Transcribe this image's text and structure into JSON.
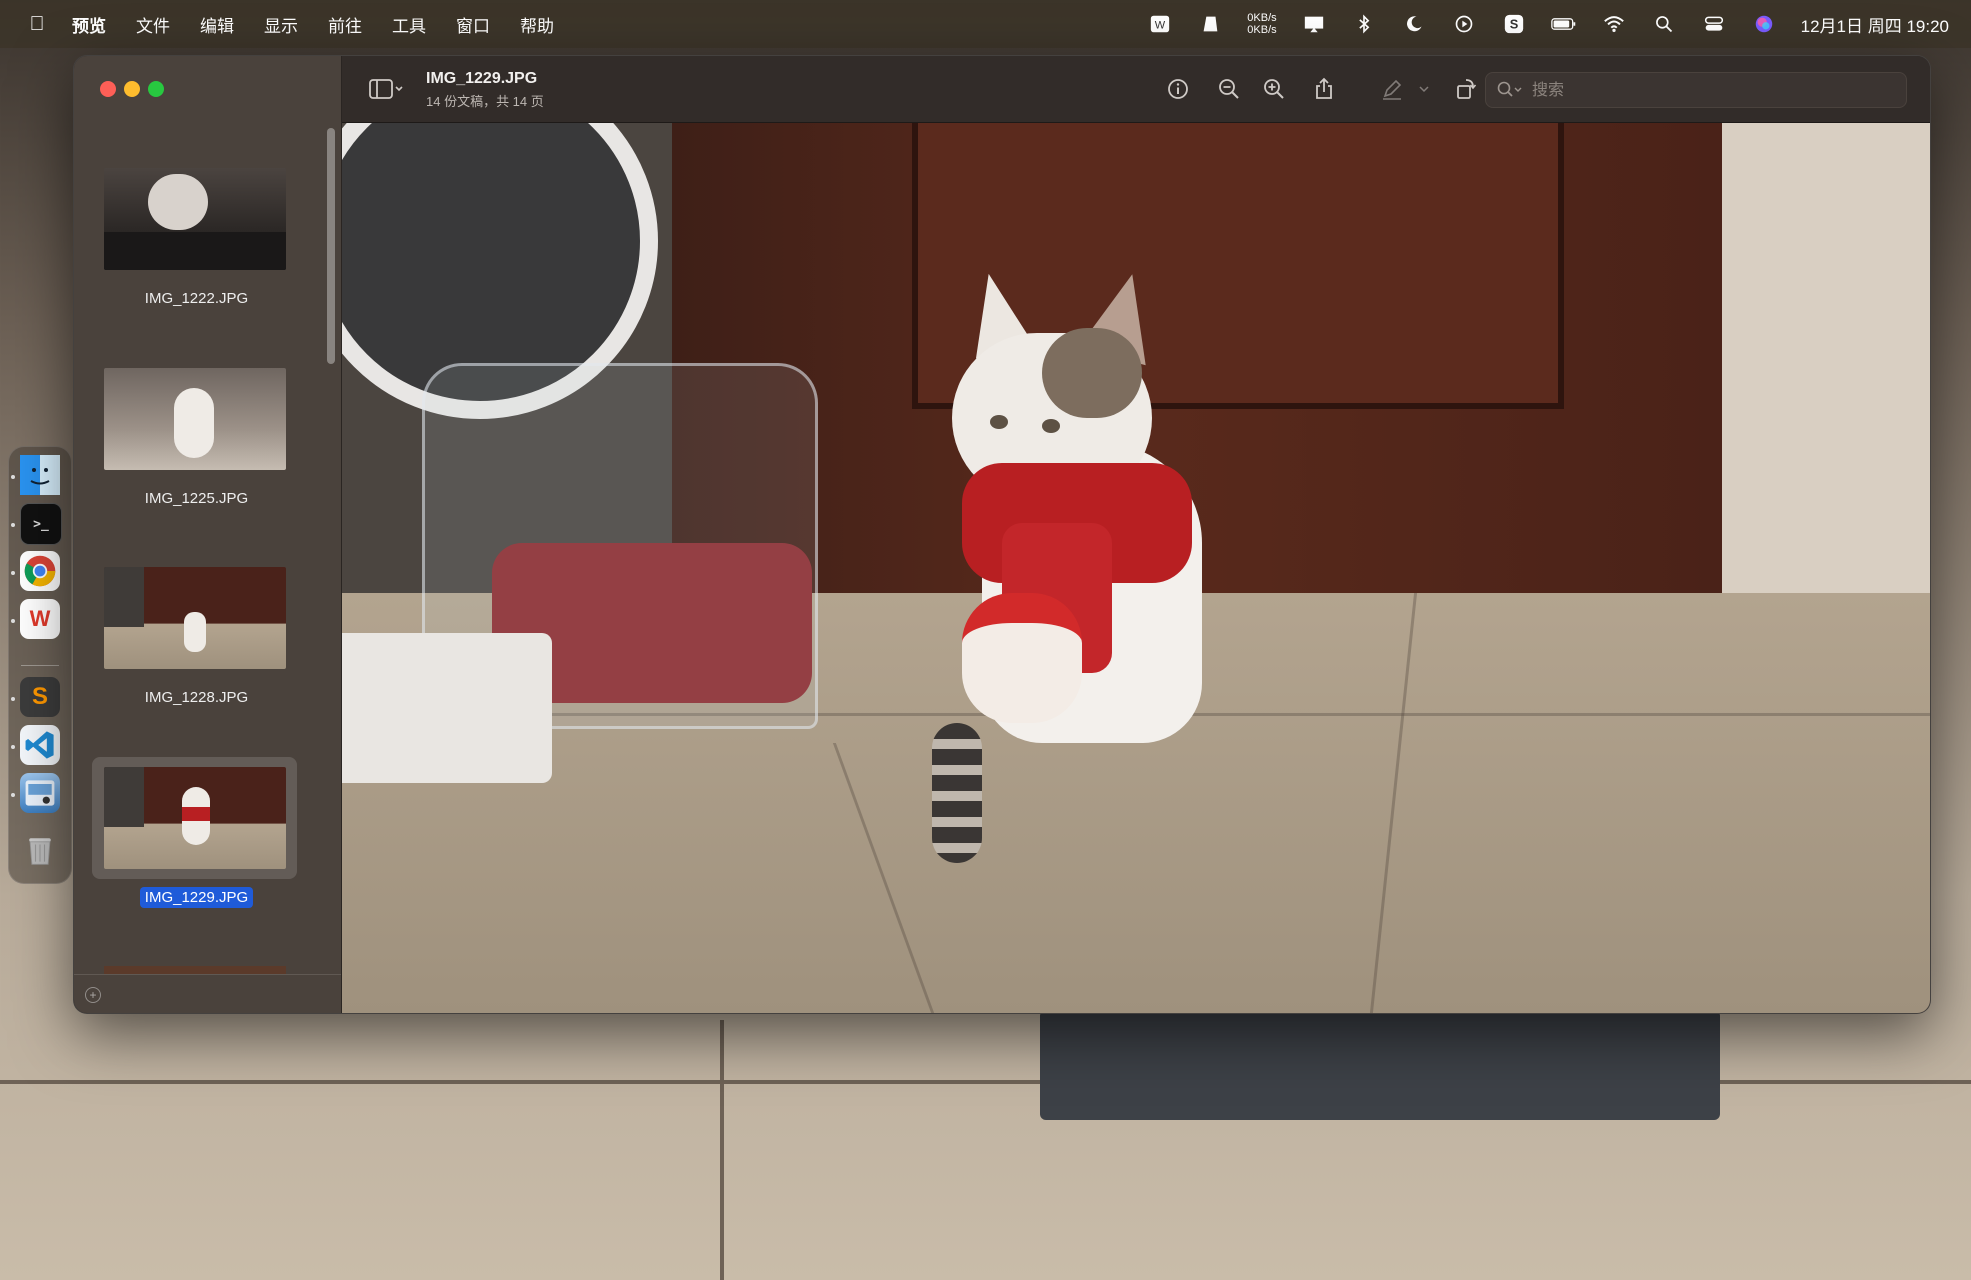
{
  "menubar": {
    "app_name": "预览",
    "items": [
      "文件",
      "编辑",
      "显示",
      "前往",
      "工具",
      "窗口",
      "帮助"
    ],
    "netspeed_up": "0KB/s",
    "netspeed_down": "0KB/s",
    "clock": "12月1日 周四 19:20"
  },
  "dock": {
    "apps": [
      "finder",
      "terminal",
      "chrome",
      "wps",
      "sublime-text",
      "vscode",
      "preview",
      "trash"
    ]
  },
  "window": {
    "title": "IMG_1229.JPG",
    "subtitle": "14 份文稿，共 14 页",
    "search_placeholder": "搜索"
  },
  "sidebar": {
    "thumbnails": [
      {
        "label": "IMG_1222.JPG",
        "selected": false
      },
      {
        "label": "IMG_1225.JPG",
        "selected": false
      },
      {
        "label": "IMG_1228.JPG",
        "selected": false
      },
      {
        "label": "IMG_1229.JPG",
        "selected": true
      }
    ]
  },
  "toolbar": {
    "icons": [
      "sidebar-toggle-icon",
      "info-icon",
      "zoom-out-icon",
      "zoom-in-icon",
      "share-icon",
      "markup-pen-icon",
      "rotate-icon",
      "annotate-icon"
    ]
  },
  "colors": {
    "selection": "#1f5bd9",
    "traffic_close": "#fe5f57",
    "traffic_min": "#febc2e",
    "traffic_max": "#28c840"
  }
}
